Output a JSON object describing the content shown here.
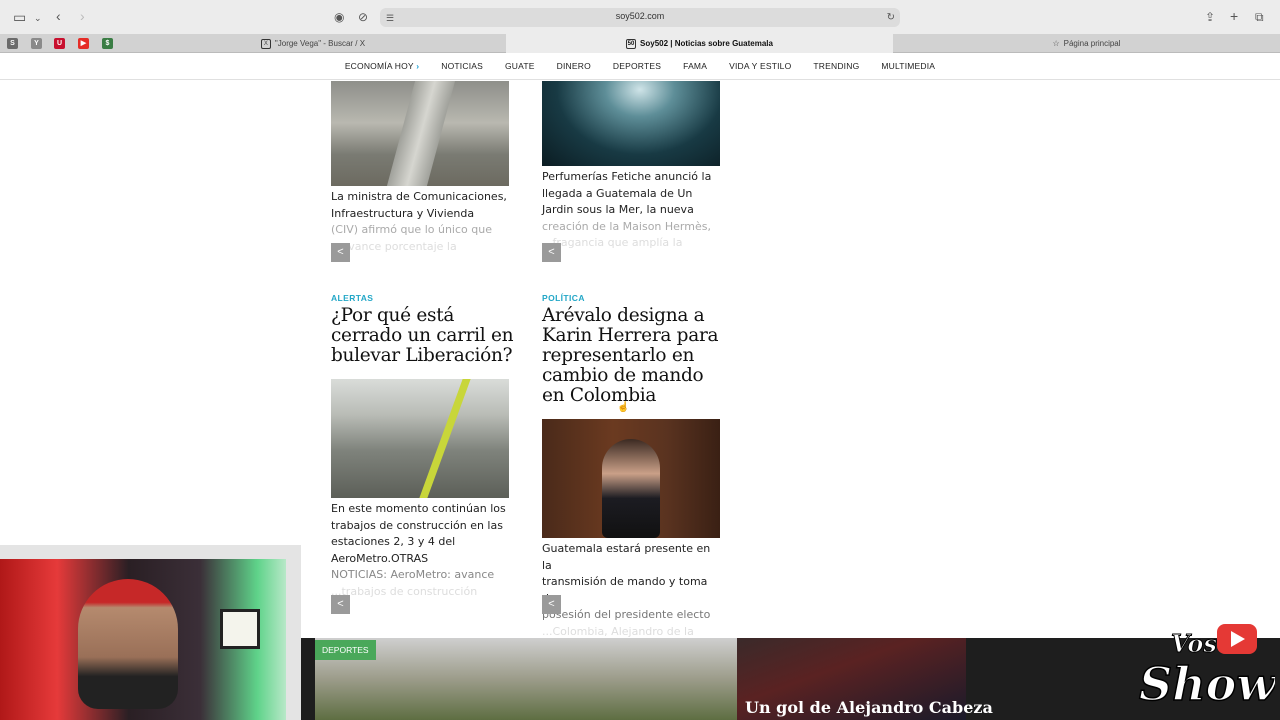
{
  "browser": {
    "url": "soy502.com",
    "tabs": [
      {
        "label": "\"Jorge Vega\" - Buscar / X",
        "fav": "X"
      },
      {
        "label": "Soy502 | Noticias sobre Guatemala",
        "fav": "50"
      },
      {
        "label": "Página principal",
        "fav": "☆"
      }
    ],
    "pinned": [
      {
        "letter": "S",
        "color": "#6b6b6b"
      },
      {
        "letter": "Y",
        "color": "#8a8a8a"
      },
      {
        "letter": "U",
        "color": "#c8102e"
      },
      {
        "letter": "▶",
        "color": "#e52d27"
      },
      {
        "letter": "$",
        "color": "#3a7d44"
      }
    ]
  },
  "nav": {
    "items": [
      "ECONOMÍA HOY",
      "NOTICIAS",
      "GUATE",
      "DINERO",
      "DEPORTES",
      "FAMA",
      "VIDA Y ESTILO",
      "TRENDING",
      "MULTIMEDIA"
    ],
    "chev": "›"
  },
  "articles_top": [
    {
      "excerpt_lines": [
        "La ministra de Comunicaciones,",
        "Infraestructura y Vivienda",
        "(CIV) afirmó que lo único que"
      ],
      "fade_line": "...avance porcentaje la"
    },
    {
      "excerpt_lines": [
        "Perfumerías Fetiche anunció la",
        "llegada a Guatemala de Un",
        "Jardin sous la Mer, la nueva"
      ],
      "fade_line": "creación de la Maison Hermès,",
      "fade_line2": "...fragancia que amplía la"
    }
  ],
  "articles_bottom": [
    {
      "category": "ALERTAS",
      "headline_lines": [
        "¿Por qué está",
        "cerrado un carril en",
        "bulevar Liberación?"
      ],
      "excerpt_lines": [
        "En este momento continúan los",
        "trabajos de construcción en las",
        "estaciones 2, 3 y 4 del",
        "AeroMetro.OTRAS"
      ],
      "fade_line": "NOTICIAS: AeroMetro: avance",
      "fade_line2": "...trabajos de construcción"
    },
    {
      "category": "POLÍTICA",
      "headline_lines": [
        "Arévalo designa a",
        "Karin Herrera para",
        "representarlo en",
        "cambio de mando",
        "en Colombia"
      ],
      "excerpt_lines": [
        "Guatemala estará presente en la",
        "transmisión de mando y toma de"
      ],
      "fade_line": "posesión del presidente electo",
      "fade_line2": "...Colombia, Alejandro de la"
    }
  ],
  "bottom": {
    "badge": "DEPORTES",
    "headline": "Un gol de Alejandro Cabeza"
  },
  "overlay": {
    "logo_top": "Vos",
    "logo_bottom": "Show"
  },
  "icons": {
    "share": "share-icon",
    "sidebar": "sidebar-icon",
    "back": "back-icon",
    "forward": "forward-icon",
    "reload": "reload-icon",
    "upload": "upload-icon",
    "newtab": "plus-icon",
    "tabs": "tabs-overview-icon"
  }
}
